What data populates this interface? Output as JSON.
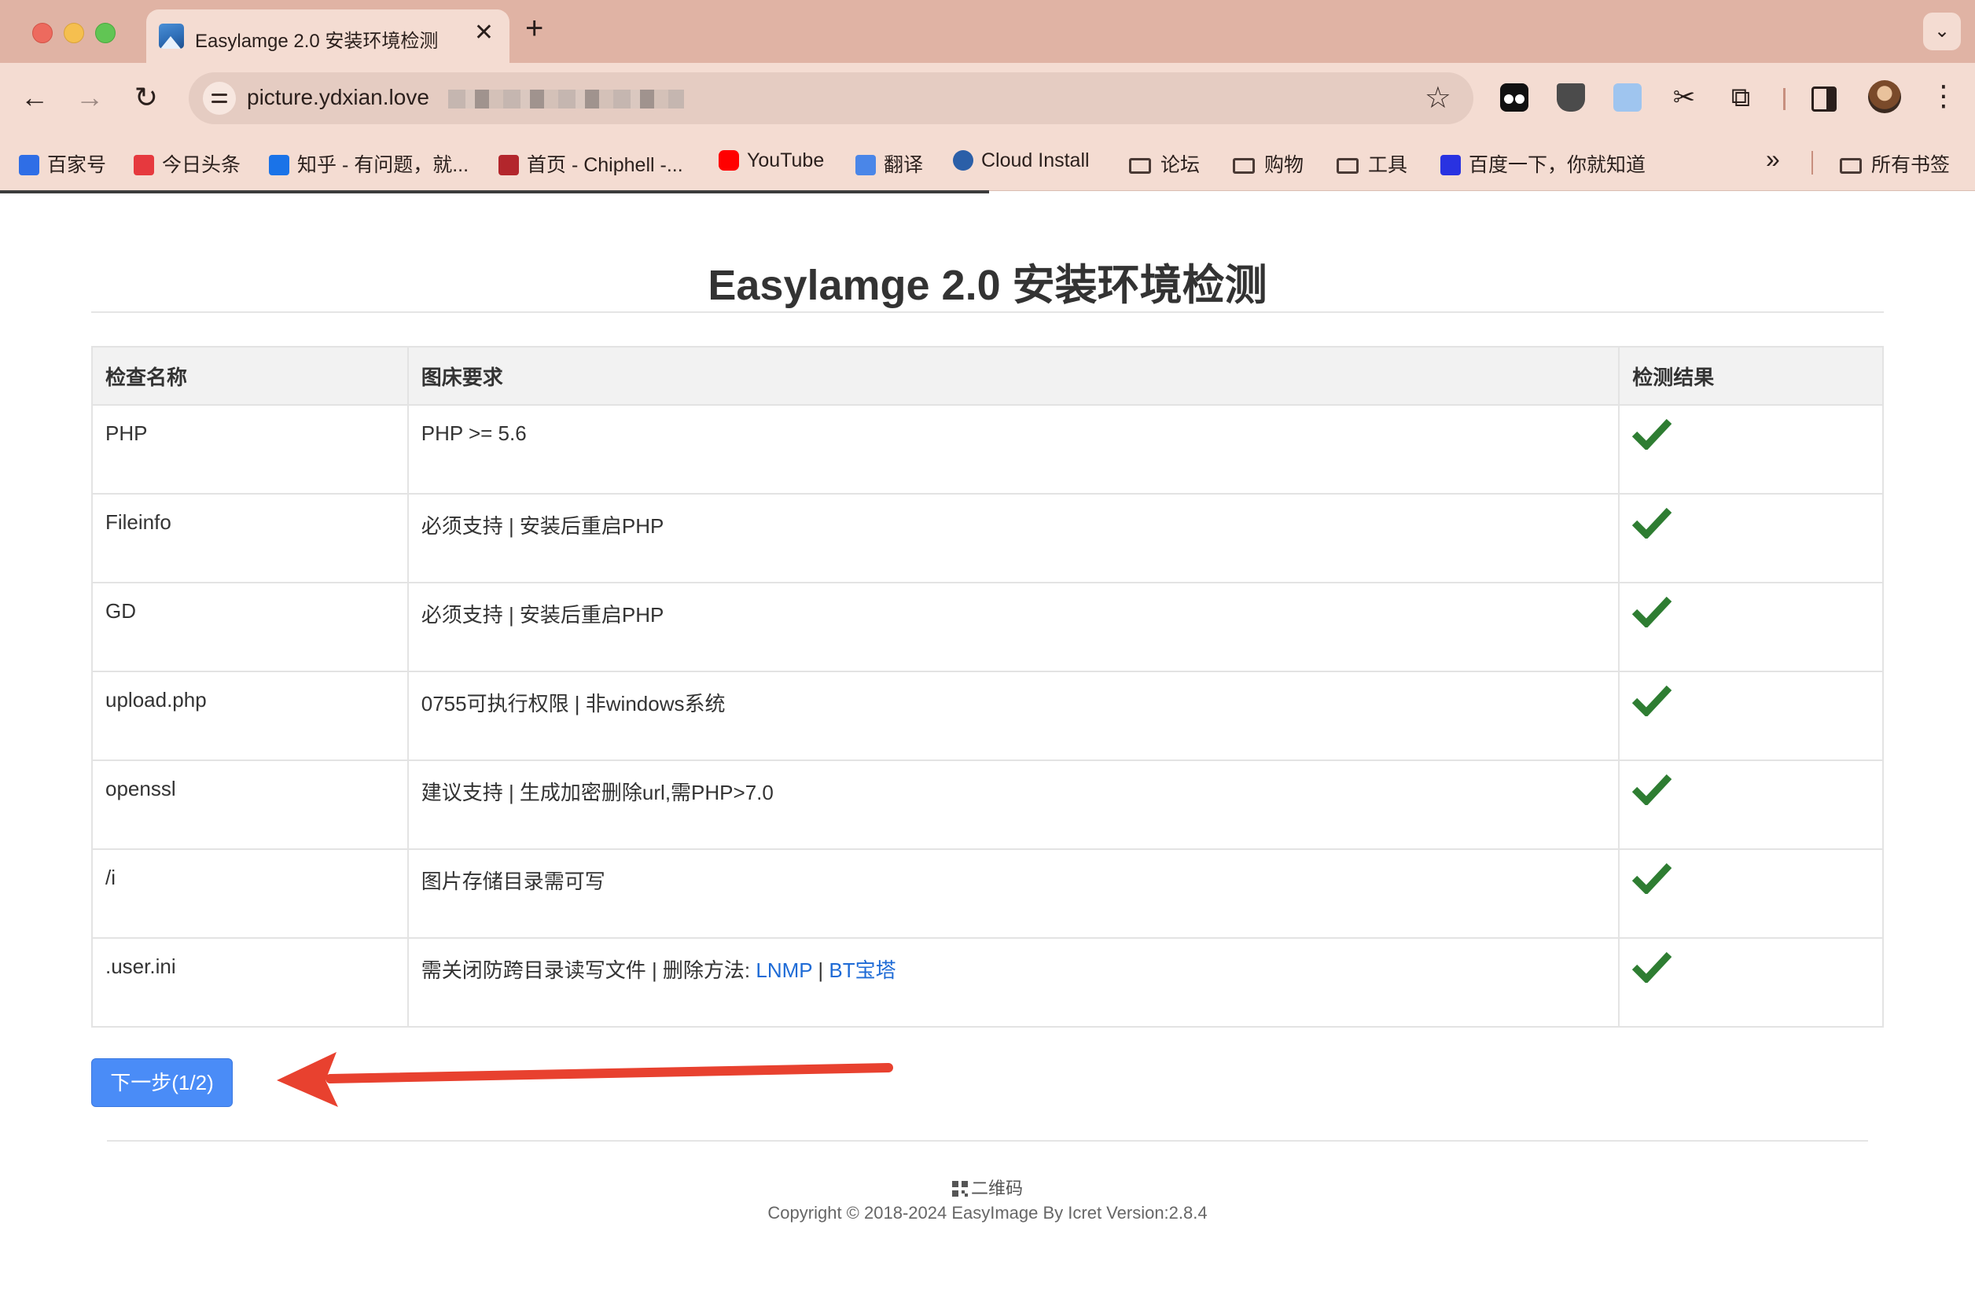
{
  "browser": {
    "tab_title": "Easylamge 2.0 安装环境检测",
    "url": "picture.ydxian.love",
    "bookmarks": [
      {
        "label": "百家号",
        "icon": "baijiahao-icon",
        "color": "#2f6ee6"
      },
      {
        "label": "今日头条",
        "icon": "toutiao-icon",
        "color": "#e6393e"
      },
      {
        "label": "知乎 - 有问题，就...",
        "icon": "zhihu-icon",
        "color": "#1a73e8"
      },
      {
        "label": "首页 - Chiphell -...",
        "icon": "chiphell-icon",
        "color": "#b3262c"
      },
      {
        "label": "YouTube",
        "icon": "youtube-icon",
        "color": "#ff0000"
      },
      {
        "label": "翻译",
        "icon": "translate-icon",
        "color": "#4a86e8"
      },
      {
        "label": "Cloud Install",
        "icon": "cloud-icon",
        "color": "#2b5fa8"
      },
      {
        "label": "论坛",
        "icon": "folder-icon"
      },
      {
        "label": "购物",
        "icon": "folder-icon"
      },
      {
        "label": "工具",
        "icon": "folder-icon"
      },
      {
        "label": "百度一下，你就知道",
        "icon": "baidu-icon",
        "color": "#2932e1"
      }
    ],
    "all_bookmarks": "所有书签"
  },
  "page": {
    "title": "Easylamge 2.0 安装环境检测",
    "table": {
      "headers": [
        "检查名称",
        "图床要求",
        "检测结果"
      ],
      "rows": [
        {
          "name": "PHP",
          "requirement": "PHP >= 5.6",
          "result": "pass"
        },
        {
          "name": "Fileinfo",
          "requirement": "必须支持 | 安装后重启PHP",
          "result": "pass"
        },
        {
          "name": "GD",
          "requirement": "必须支持 | 安装后重启PHP",
          "result": "pass"
        },
        {
          "name": "upload.php",
          "requirement": "0755可执行权限 | 非windows系统",
          "result": "pass"
        },
        {
          "name": "openssl",
          "requirement": "建议支持 | 生成加密删除url,需PHP>7.0",
          "result": "pass"
        },
        {
          "name": "/i",
          "requirement": "图片存储目录需可写",
          "result": "pass"
        },
        {
          "name": ".user.ini",
          "requirement": "需关闭防跨目录读写文件 | 删除方法: ",
          "links": [
            "LNMP",
            "BT宝塔"
          ],
          "link_sep": " | ",
          "result": "pass"
        }
      ]
    },
    "next_button": "下一步(1/2)",
    "qr_label": "二维码",
    "copyright": "Copyright © 2018-2024 EasyImage By Icret Version:2.8.4"
  },
  "colors": {
    "tick": "#2e7d32",
    "button": "#4a8cf7",
    "link": "#1e6bd6",
    "arrow": "#e8412f"
  }
}
